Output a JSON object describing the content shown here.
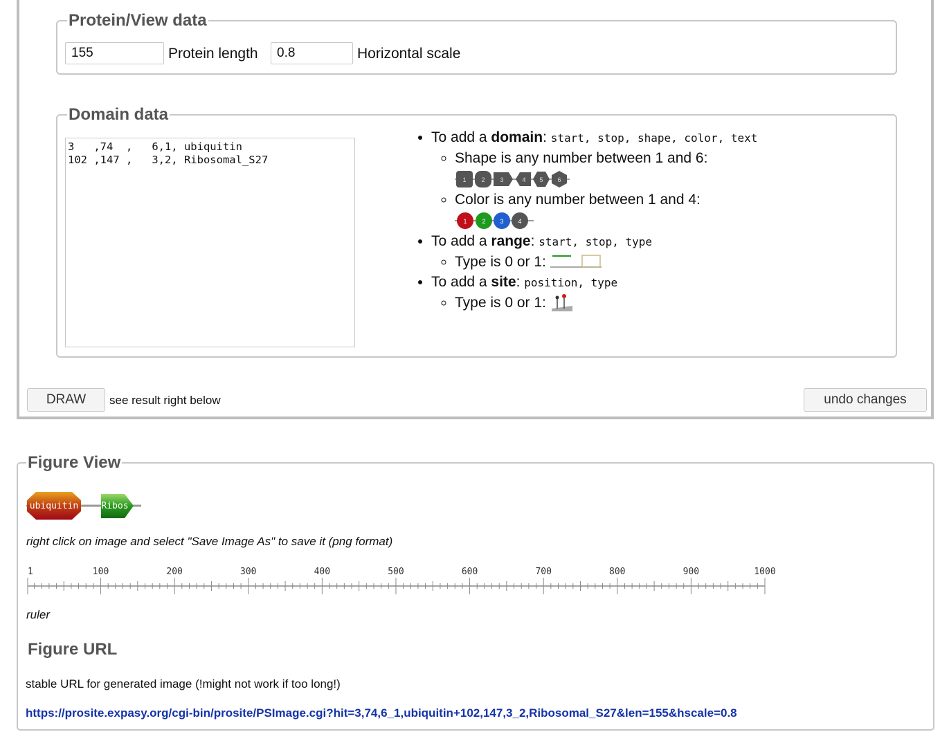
{
  "protein_view": {
    "legend": "Protein/View data",
    "length_value": "155",
    "length_label": "Protein length",
    "hscale_value": "0.8",
    "hscale_label": "Horizontal scale"
  },
  "domain_data": {
    "legend": "Domain data",
    "textarea_value": "3   ,74  ,   6,1, ubiquitin\n102 ,147 ,   3,2, Ribosomal_S27\n",
    "help": {
      "domain_prefix": "To add a ",
      "domain_word": "domain",
      "domain_params": "start, stop, shape, color, text",
      "shape_text": "Shape is any number between 1 and 6:",
      "shape_numbers": [
        "1",
        "2",
        "3",
        "4",
        "5",
        "6"
      ],
      "color_text": "Color is any number between 1 and 4:",
      "color_numbers": [
        "1",
        "2",
        "3",
        "4"
      ],
      "range_prefix": "To add a ",
      "range_word": "range",
      "range_params": "start, stop, type",
      "range_type_text": "Type is 0 or 1:",
      "site_prefix": "To add a ",
      "site_word": "site",
      "site_params": "position, type",
      "site_type_text": "Type is 0 or 1:"
    }
  },
  "actions": {
    "draw_label": "DRAW",
    "draw_hint": "see result right below",
    "undo_label": "undo changes"
  },
  "figure_view": {
    "legend": "Figure View",
    "domain1_text": "ubiquitin",
    "domain2_text": "Ribos",
    "save_hint": "right click on image and select \"Save Image As\" to save it (png format)",
    "ruler_ticks": [
      "1",
      "100",
      "200",
      "300",
      "400",
      "500",
      "600",
      "700",
      "800",
      "900",
      "1000"
    ],
    "ruler_caption": "ruler",
    "url_heading": "Figure URL",
    "url_note": "stable URL for generated image (!might not work if too long!)",
    "url": "https://prosite.expasy.org/cgi-bin/prosite/PSImage.cgi?hit=3,74,6_1,ubiquitin+102,147,3_2,Ribosomal_S27&len=155&hscale=0.8"
  },
  "colors": {
    "domain_red": "#c0101a",
    "domain_green": "#1f9a1f",
    "domain_blue": "#1f5fd0",
    "domain_gray": "#555555",
    "link": "#1533a8",
    "border": "#c8c8c8"
  }
}
